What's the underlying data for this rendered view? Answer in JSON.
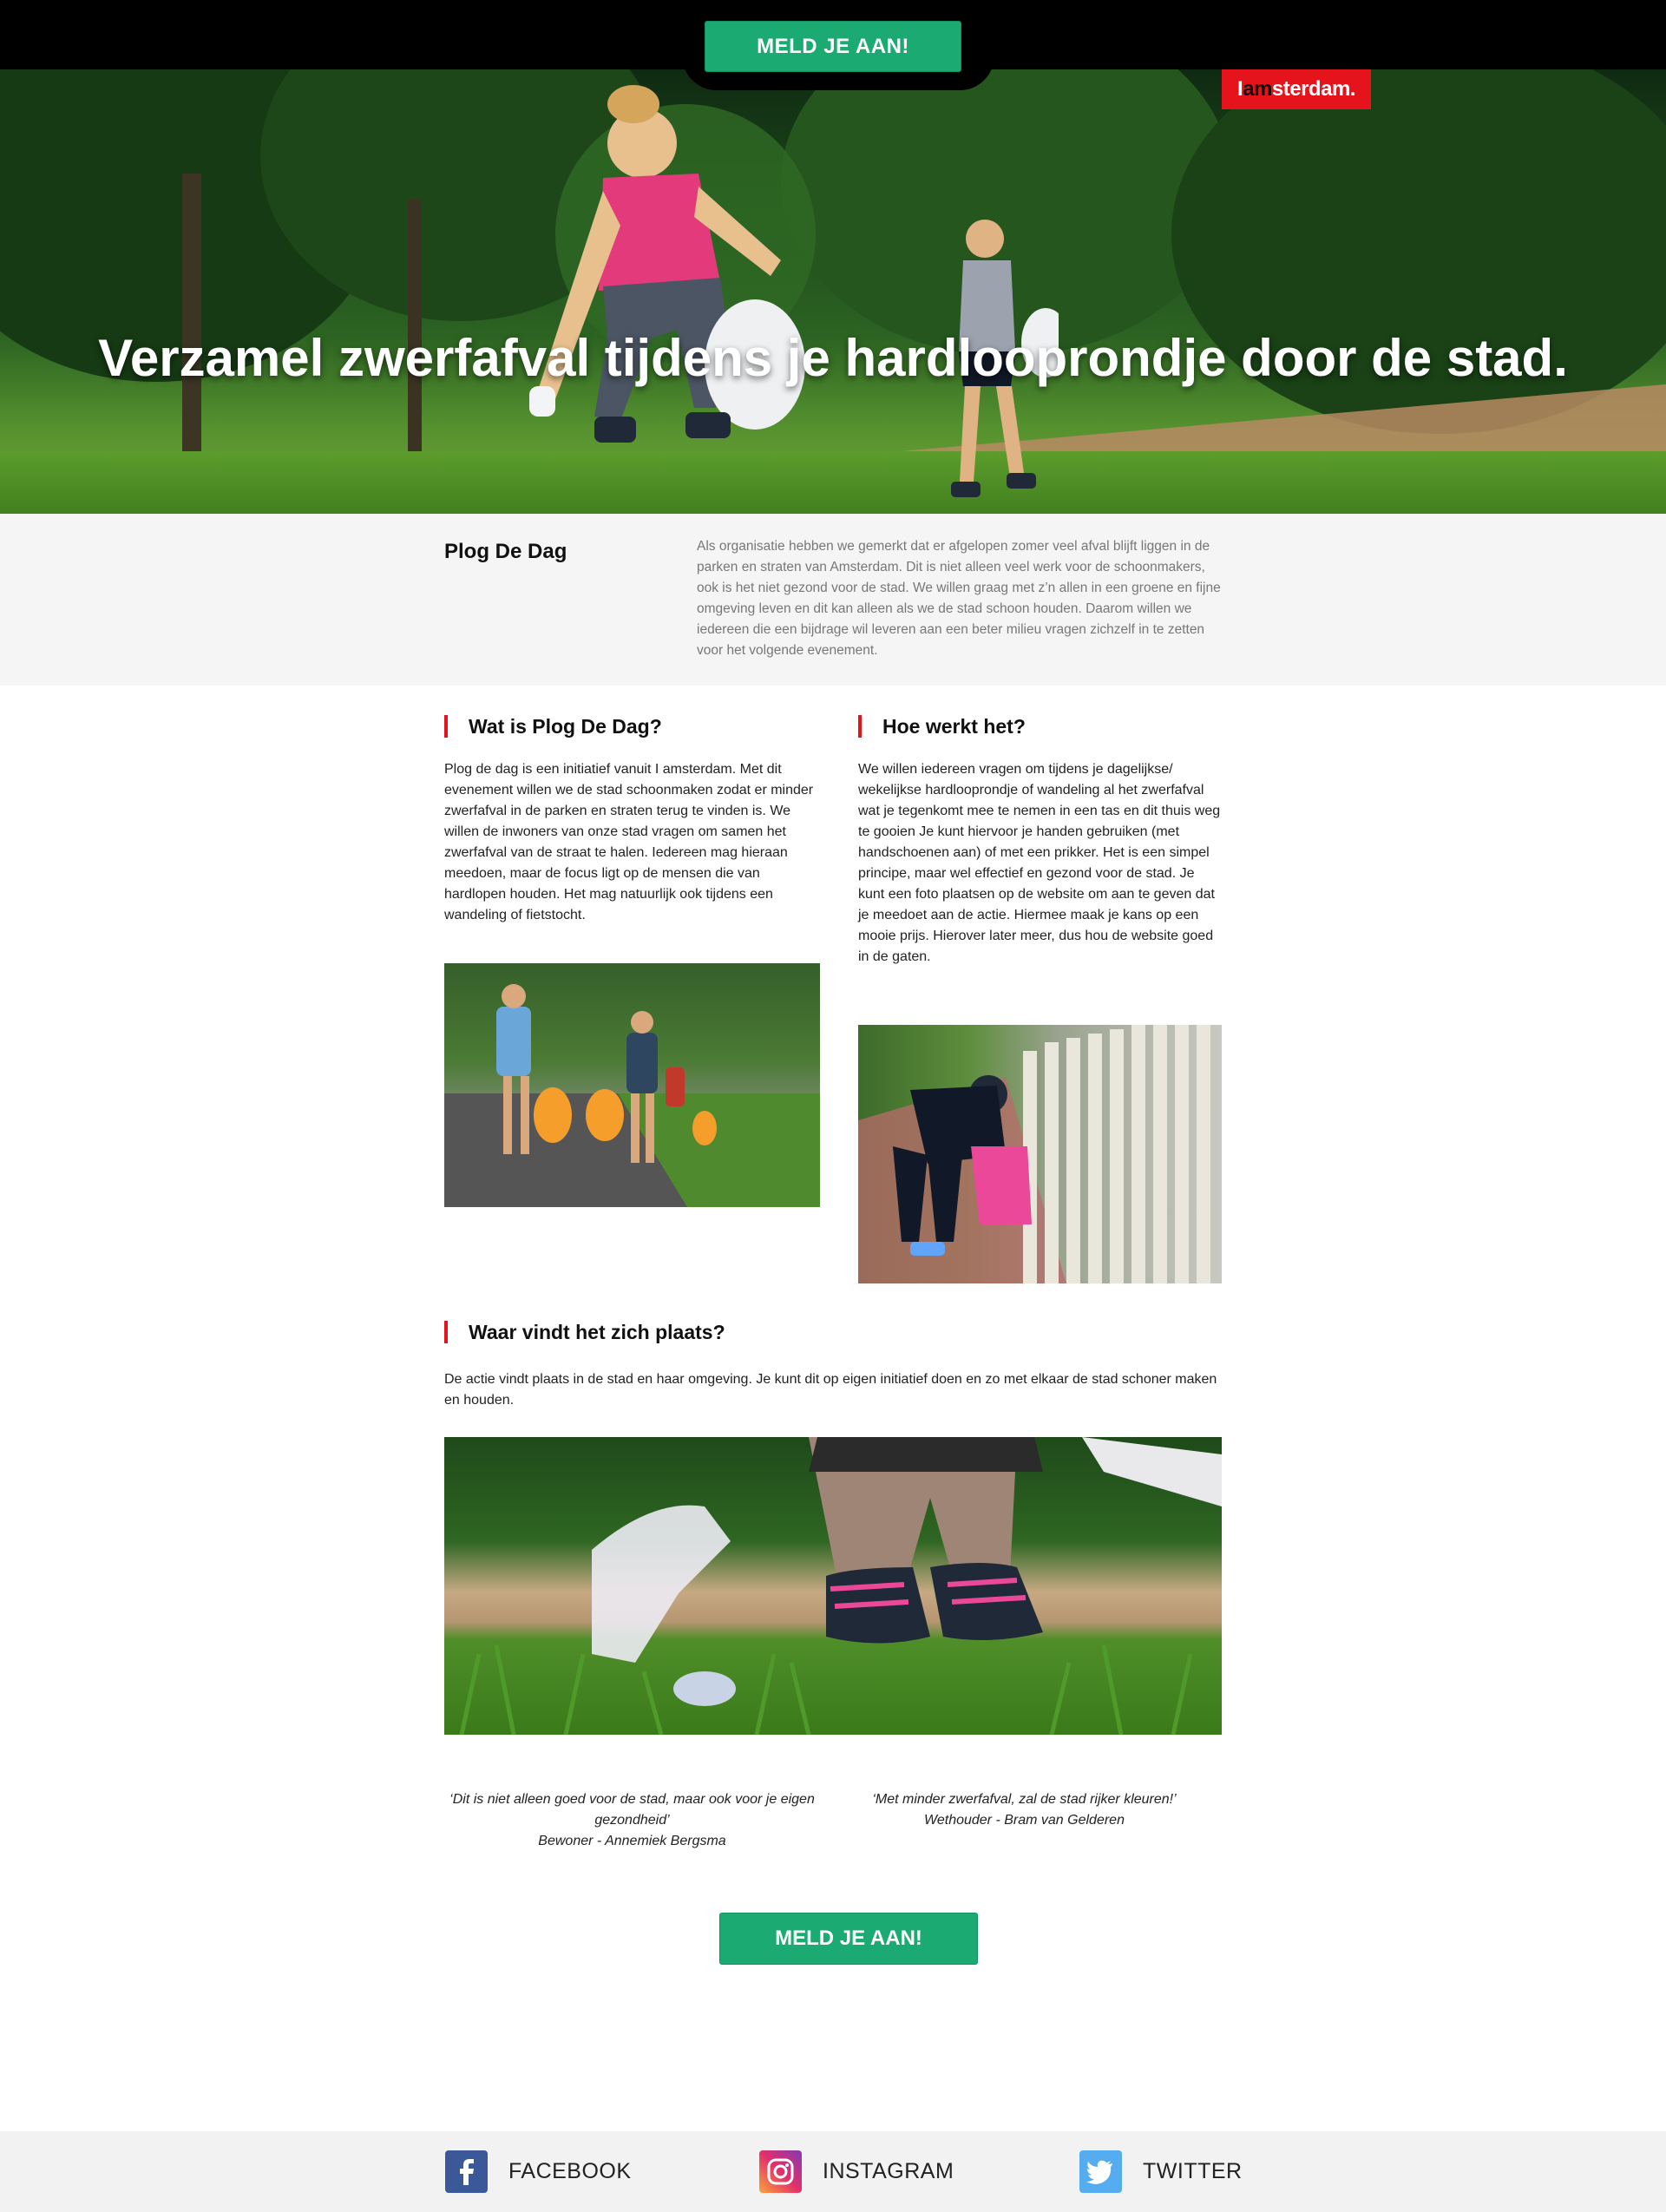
{
  "top_bar": {
    "cta_label": "MELD JE AAN!"
  },
  "hero": {
    "title": "Verzamel zwerfafval tijdens je hardlooprondje door de stad.",
    "logo": {
      "prefix": "I ",
      "am": "am",
      "rest": "sterdam."
    }
  },
  "intro": {
    "title": "Plog De Dag",
    "text": "Als organisatie hebben we gemerkt dat er afgelopen zomer veel afval blijft liggen in de parken en straten van Amsterdam. Dit is niet alleen veel werk voor de schoonmakers, ook is het niet gezond voor de stad. We willen graag met z’n allen in een groene en fijne omgeving leven en dit kan alleen als we de stad schoon houden. Daarom willen we iedereen die een bijdrage wil leveren aan een beter milieu vragen zichzelf in te zetten voor het volgende evenement."
  },
  "sections": {
    "what": {
      "title": "Wat is Plog De Dag?",
      "text": "Plog de dag is een initiatief vanuit I amsterdam. Met dit evenement willen we de stad schoonmaken zodat er minder zwerfafval in de parken en straten terug te vinden is. We willen de inwoners van onze stad vragen om samen het zwerfafval van de straat te halen. Iedereen mag hieraan meedoen, maar de focus ligt op de mensen die van hardlopen houden. Het mag natuurlijk ook tijdens een wandeling of fietstocht."
    },
    "how": {
      "title": "Hoe werkt het?",
      "text": "We willen iedereen vragen om tijdens je dagelijkse/ wekelijkse hardlooprondje of wandeling al het zwerfafval wat je tegenkomt mee te nemen in een tas en dit thuis weg te gooien Je kunt hiervoor je handen gebruiken (met handschoenen aan) of met een prikker. Het is een simpel principe, maar wel effectief en gezond voor de stad. Je kunt een foto plaatsen op de website om aan te geven dat je meedoet aan de actie. Hiermee maak je kans op een mooie prijs. Hierover later meer, dus hou de website goed in de gaten."
    },
    "where": {
      "title": "Waar vindt het zich plaats?",
      "text": "De actie vindt plaats in de stad en haar omgeving. Je kunt dit op eigen initiatief doen en zo met elkaar de stad schoner maken en houden."
    }
  },
  "quotes": [
    {
      "text": "‘Dit is niet alleen goed voor de stad, maar ook voor je eigen gezondheid’",
      "author": "Bewoner - Annemiek Bergsma"
    },
    {
      "text": "‘Met minder zwerfafval, zal de stad rijker kleuren!’",
      "author": "Wethouder - Bram van Gelderen"
    }
  ],
  "bottom_cta": {
    "label": "MELD JE AAN!"
  },
  "footer": {
    "social": [
      {
        "label": "FACEBOOK",
        "icon": "facebook-icon",
        "color": "#3b5998"
      },
      {
        "label": "INSTAGRAM",
        "icon": "instagram-icon",
        "color": "#c13584"
      },
      {
        "label": "TWITTER",
        "icon": "twitter-icon",
        "color": "#55acee"
      }
    ]
  },
  "colors": {
    "accent_green": "#1aaa72",
    "brand_red": "#e4131c",
    "intro_bg": "#f5f5f5",
    "footer_bg": "#f2f2f2"
  }
}
